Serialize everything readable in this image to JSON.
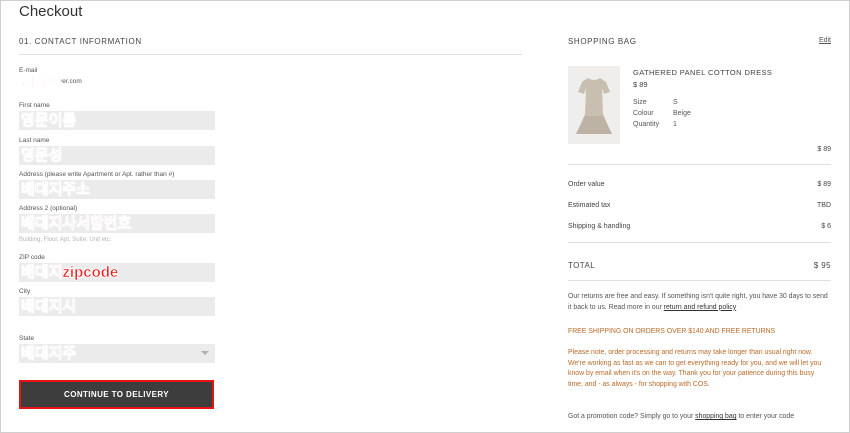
{
  "page": {
    "title": "Checkout"
  },
  "contact": {
    "heading": "01.  CONTACT INFORMATION",
    "email_label": "E-mail",
    "email_value": "이메일",
    "email_tail": "ver.com",
    "first_name_label": "First name",
    "first_name_value": "영문이름",
    "last_name_label": "Last name",
    "last_name_value": "영문성",
    "address_label": "Address (please write Apartment or Apt. rather than #)",
    "address_value": "배대지주소",
    "address2_label": "Address 2 (optional)",
    "address2_value": "배대지사서함번호",
    "address2_hint": "Building, Floor, Apt, Suite, Unit etc.",
    "zip_label": "ZIP code",
    "zip_value": "배대지zipcode",
    "city_label": "City",
    "city_value": "배대지시",
    "state_label": "State",
    "state_value": "배대지주",
    "continue_label": "CONTINUE TO DELIVERY"
  },
  "bag": {
    "heading": "SHOPPING BAG",
    "edit_label": "Edit",
    "product": {
      "name": "GATHERED PANEL COTTON DRESS",
      "price": "$ 89",
      "size_label": "Size",
      "size_value": "S",
      "colour_label": "Colour",
      "colour_value": "Beige",
      "quantity_label": "Quantity",
      "quantity_value": "1",
      "line_total": "$ 89",
      "image": "dress-image"
    },
    "summary": {
      "order_value_label": "Order value",
      "order_value": "$ 89",
      "tax_label": "Estimated tax",
      "tax_value": "TBD",
      "shipping_label": "Shipping & handling",
      "shipping_value": "$ 6",
      "total_label": "TOTAL",
      "total_value": "$ 95"
    },
    "returns_text": "Our returns are free and easy. If something isn't quite right, you have 30 days to send it back to us. Read more in our",
    "returns_link": "return and refund policy",
    "free_shipping": "FREE SHIPPING ON ORDERS OVER $140 AND FREE RETURNS",
    "delay_note": "Please note, order processing and returns may take longer than usual right now. We're working as fast as we can to get everything ready for you, and we will let you know by email when it's on the way. Thank you for your patience during this busy time, and - as always - for shopping with COS.",
    "promo_text_before": "Got a promotion code? Simply go to your",
    "promo_link": "shopping bag",
    "promo_text_after": "to enter your code"
  },
  "colors": {
    "accent_red": "#e81313",
    "button_bg": "#3d3d3d",
    "notice_orange": "#b96a2a"
  }
}
